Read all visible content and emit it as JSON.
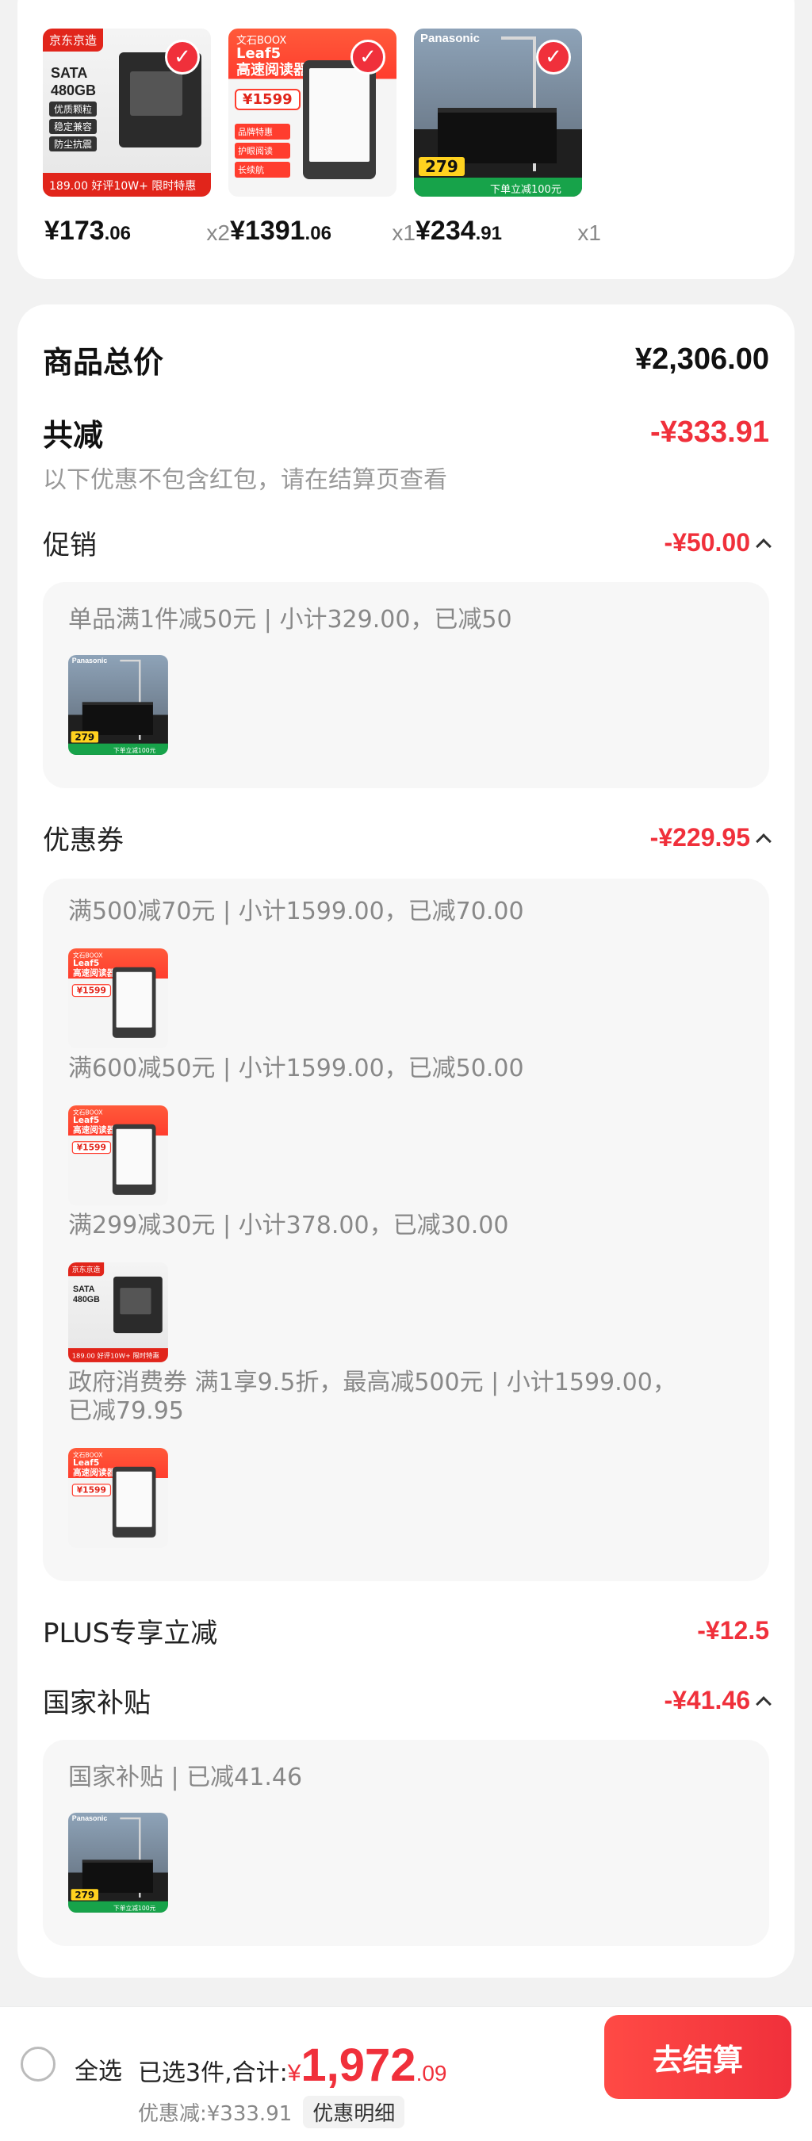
{
  "products": [
    {
      "price_int": "¥173",
      "price_dec": ".06",
      "qty": "x2",
      "thumb": {
        "brand": "京东京造",
        "model": "SATA\n480GB",
        "tags": [
          "优质颗粒",
          "稳定兼容",
          "防尘抗震"
        ],
        "bar": "189.00  好评10W+ 限时特惠"
      }
    },
    {
      "price_int": "¥1391",
      "price_dec": ".06",
      "qty": "x1",
      "thumb": {
        "logo": "文石BOOX",
        "title": "Leaf5\n高速阅读器",
        "tag": "¥1599",
        "side": [
          "品牌特惠",
          "护眼阅读",
          "长续航"
        ]
      }
    },
    {
      "price_int": "¥234",
      "price_dec": ".91",
      "qty": "x1",
      "thumb": {
        "logo": "Panasonic",
        "tag": "279",
        "bar": "下单立减100元"
      }
    }
  ],
  "summary": {
    "total_label": "商品总价",
    "total_value": "¥2,306.00",
    "reduce_label": "共减",
    "reduce_value": "-¥333.91",
    "reduce_note": "以下优惠不包含红包，请在结算页查看",
    "promo": {
      "label": "促销",
      "value": "-¥50.00",
      "lines": [
        "单品满1件减50元 | 小计329.00，已减50"
      ]
    },
    "coupon": {
      "label": "优惠券",
      "value": "-¥229.95",
      "lines": [
        "满500减70元 | 小计1599.00，已减70.00",
        "满600减50元 | 小计1599.00，已减50.00",
        "满299减30元 | 小计378.00，已减30.00",
        "政府消费券 满1享9.5折，最高减500元 | 小计1599.00，",
        "已减79.95"
      ]
    },
    "plus": {
      "label": "PLUS专享立减",
      "value": "-¥12.5"
    },
    "subsidy": {
      "label": "国家补贴",
      "value": "-¥41.46",
      "lines": [
        "国家补贴 | 已减41.46"
      ]
    }
  },
  "bottom": {
    "select_all": "全选",
    "selected_text": "已选3件,合计:",
    "yen": "¥",
    "total_int": "1,972",
    "total_dec": ".09",
    "saved_text": "优惠减:¥333.91",
    "detail_label": "优惠明细",
    "checkout_label": "去结算"
  },
  "colors": {
    "accent": "#f0303b",
    "background": "#f2f2f2",
    "card": "#ffffff"
  }
}
